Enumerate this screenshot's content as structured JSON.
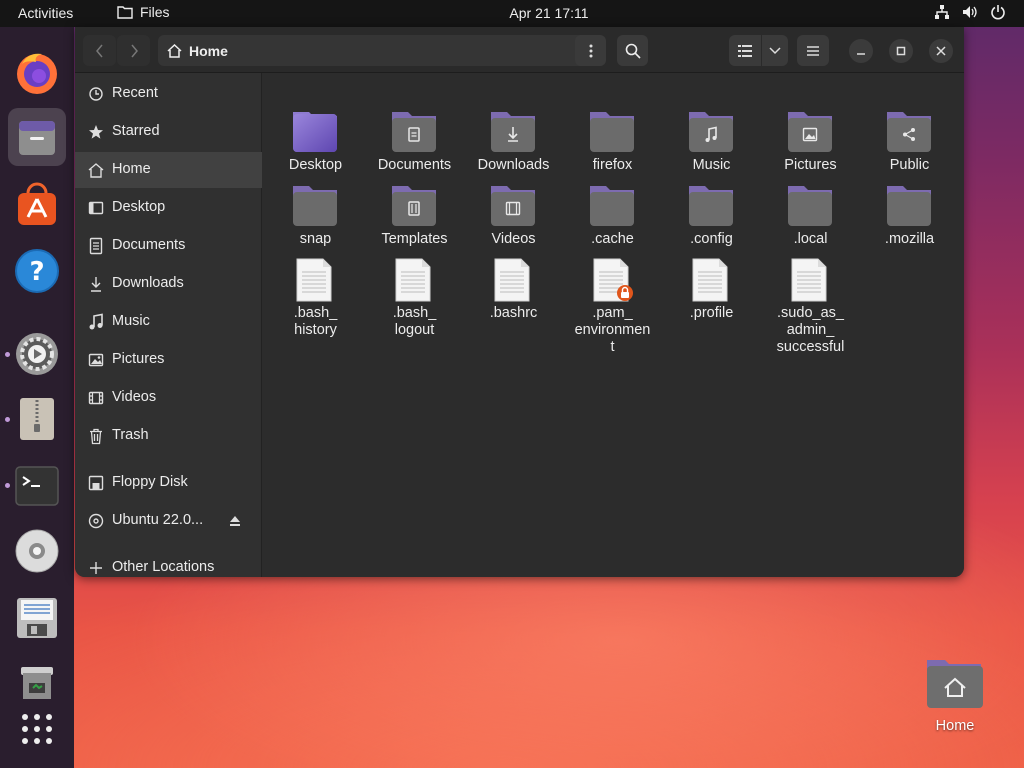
{
  "topbar": {
    "activities": "Activities",
    "app_name": "Files",
    "clock": "Apr 21  17:11",
    "tray": [
      "network-icon",
      "volume-icon",
      "power-icon"
    ]
  },
  "dock": {
    "items": [
      {
        "name": "firefox",
        "icon": "firefox-icon"
      },
      {
        "name": "files",
        "icon": "files-icon",
        "active": true
      },
      {
        "name": "app-center",
        "icon": "ubuntu-software-icon"
      },
      {
        "name": "help",
        "icon": "help-icon"
      },
      {
        "name": "settings",
        "icon": "settings-icon"
      },
      {
        "name": "archive-manager",
        "icon": "archive-icon"
      },
      {
        "name": "terminal",
        "icon": "terminal-icon"
      },
      {
        "name": "optical-disc",
        "icon": "cd-icon"
      },
      {
        "name": "floppy",
        "icon": "floppy-icon"
      },
      {
        "name": "trash",
        "icon": "trash-icon"
      },
      {
        "name": "show-apps",
        "icon": "grid-icon"
      }
    ]
  },
  "window": {
    "path": "Home",
    "sidebar": [
      {
        "label": "Recent",
        "icon": "clock-icon"
      },
      {
        "label": "Starred",
        "icon": "star-icon"
      },
      {
        "label": "Home",
        "icon": "home-icon",
        "selected": true
      },
      {
        "label": "Desktop",
        "icon": "desktop-icon"
      },
      {
        "label": "Documents",
        "icon": "document-icon"
      },
      {
        "label": "Downloads",
        "icon": "download-icon"
      },
      {
        "label": "Music",
        "icon": "music-icon"
      },
      {
        "label": "Pictures",
        "icon": "picture-icon"
      },
      {
        "label": "Videos",
        "icon": "video-icon"
      },
      {
        "label": "Trash",
        "icon": "trash-icon"
      },
      {
        "label": "Floppy Disk",
        "icon": "floppy-icon"
      },
      {
        "label": "Ubuntu 22.0...",
        "icon": "disc-icon"
      },
      {
        "label": "Other Locations",
        "icon": "plus-icon"
      }
    ],
    "files": [
      {
        "label": "Desktop",
        "type": "folder-desktop"
      },
      {
        "label": "Documents",
        "type": "folder",
        "emblem": "document"
      },
      {
        "label": "Downloads",
        "type": "folder",
        "emblem": "download"
      },
      {
        "label": "firefox",
        "type": "folder"
      },
      {
        "label": "Music",
        "type": "folder",
        "emblem": "music"
      },
      {
        "label": "Pictures",
        "type": "folder",
        "emblem": "picture"
      },
      {
        "label": "Public",
        "type": "folder",
        "emblem": "share"
      },
      {
        "label": "snap",
        "type": "folder"
      },
      {
        "label": "Templates",
        "type": "folder",
        "emblem": "template"
      },
      {
        "label": "Videos",
        "type": "folder",
        "emblem": "video"
      },
      {
        "label": ".cache",
        "type": "folder"
      },
      {
        "label": ".config",
        "type": "folder"
      },
      {
        "label": ".local",
        "type": "folder"
      },
      {
        "label": ".mozilla",
        "type": "folder"
      },
      {
        "label": ".bash_\nhistory",
        "type": "file"
      },
      {
        "label": ".bash_\nlogout",
        "type": "file"
      },
      {
        "label": ".bashrc",
        "type": "file"
      },
      {
        "label": ".pam_\nenvironmen\nt",
        "type": "file",
        "locked": true
      },
      {
        "label": ".profile",
        "type": "file"
      },
      {
        "label": ".sudo_as_\nadmin_\nsuccessful",
        "type": "file"
      }
    ]
  },
  "desktop": {
    "home_label": "Home"
  },
  "colors": {
    "folder_top": "#7d6bb0",
    "folder_body": "#6b6b6b",
    "accent": "#c09ad8",
    "lock": "#e0561c"
  }
}
